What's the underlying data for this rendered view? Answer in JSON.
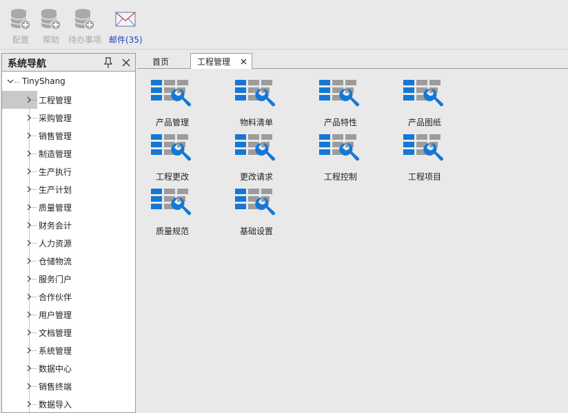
{
  "toolbar": {
    "items": [
      {
        "label": "配置",
        "icon": "database-add-icon",
        "enabled": false
      },
      {
        "label": "帮助",
        "icon": "database-add-icon",
        "enabled": false
      },
      {
        "label": "待办事项",
        "icon": "database-add-icon",
        "enabled": false
      },
      {
        "label": "邮件(35)",
        "icon": "mail-envelope-icon",
        "enabled": true
      }
    ]
  },
  "nav": {
    "title": "系统导航",
    "root": "TinyShang",
    "items": [
      {
        "label": "工程管理",
        "selected": true
      },
      {
        "label": "采购管理"
      },
      {
        "label": "销售管理"
      },
      {
        "label": "制造管理"
      },
      {
        "label": "生产执行"
      },
      {
        "label": "生产计划"
      },
      {
        "label": "质量管理"
      },
      {
        "label": "财务会计"
      },
      {
        "label": "人力资源"
      },
      {
        "label": "仓储物流"
      },
      {
        "label": "服务门户"
      },
      {
        "label": "合作伙伴"
      },
      {
        "label": "用户管理"
      },
      {
        "label": "文档管理"
      },
      {
        "label": "系统管理"
      },
      {
        "label": "数据中心"
      },
      {
        "label": "销售终端"
      },
      {
        "label": "数据导入"
      }
    ]
  },
  "tabs": [
    {
      "label": "首页",
      "active": false
    },
    {
      "label": "工程管理",
      "active": true,
      "closable": true
    }
  ],
  "tiles": [
    {
      "label": "产品管理"
    },
    {
      "label": "物料清单"
    },
    {
      "label": "产品特性"
    },
    {
      "label": "产品图纸"
    },
    {
      "label": "工程更改"
    },
    {
      "label": "更改请求"
    },
    {
      "label": "工程控制"
    },
    {
      "label": "工程项目"
    },
    {
      "label": "质量规范"
    },
    {
      "label": "基础设置"
    }
  ],
  "colors": {
    "accent_blue": "#1478d4",
    "tile_gray": "#9c9c9c",
    "mail_link": "#1a3fbf",
    "disabled_text": "#a8a8a8",
    "selected_row": "#c9c9c9"
  }
}
